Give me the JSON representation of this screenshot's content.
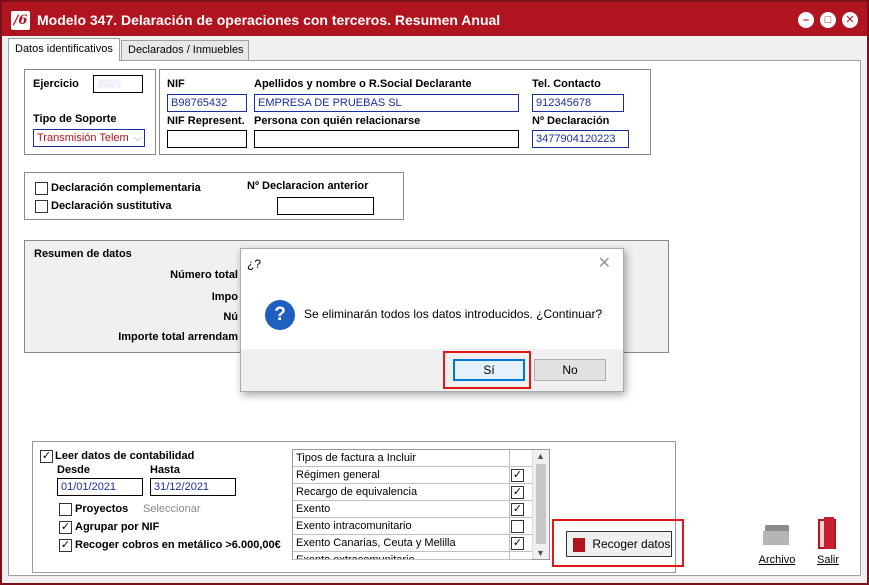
{
  "window": {
    "logo": "/6",
    "title": "Modelo 347. Delaración de operaciones con terceros. Resumen Anual",
    "controls": {
      "minimize": "–",
      "maximize": "□",
      "close": "✕"
    }
  },
  "tabs": [
    {
      "label": "Datos identificativos"
    },
    {
      "label": "Declarados / Inmuebles"
    }
  ],
  "ident": {
    "ejercicio_label": "Ejercicio",
    "ejercicio_value": "2021",
    "tipo_soporte_label": "Tipo de Soporte",
    "tipo_soporte_value": "Transmisión Telem",
    "nif_label": "NIF",
    "nif_value": "B98765432",
    "nombre_label": "Apellidos y nombre o R.Social Declarante",
    "nombre_value": "EMPRESA DE PRUEBAS SL",
    "tel_label": "Tel. Contacto",
    "tel_value": "912345678",
    "nif_rep_label": "NIF Represent.",
    "nif_rep_value": "",
    "persona_label": "Persona con quién relacionarse",
    "persona_value": "",
    "num_decl_label": "Nº Declaración",
    "num_decl_value": "3477904120223"
  },
  "decl": {
    "complementaria_label": "Declaración complementaria",
    "sustitutiva_label": "Declaración sustitutiva",
    "anterior_label": "Nº Declaracion anterior",
    "anterior_value": ""
  },
  "resumen": {
    "title": "Resumen de datos",
    "row1": "Número total",
    "row2": "Impo",
    "row3": "Nú",
    "row4": "Importe total arrendam"
  },
  "dialog": {
    "title": "¿?",
    "close": "✕",
    "icon": "?",
    "message": "Se eliminarán todos los datos introducidos. ¿Continuar?",
    "yes": "Sí",
    "no": "No"
  },
  "contab": {
    "leer_label": "Leer datos de contabilidad",
    "leer_checked": true,
    "desde_label": "Desde",
    "desde_value": "01/01/2021",
    "hasta_label": "Hasta",
    "hasta_value": "31/12/2021",
    "proyectos_label": "Proyectos",
    "proyectos_checked": false,
    "seleccionar_label": "Seleccionar",
    "agrupar_label": "Agrupar por NIF",
    "agrupar_checked": true,
    "cobros_label": "Recoger cobros en metálico >6.000,00€",
    "cobros_checked": true
  },
  "tipos": {
    "header": "Tipos de factura a Incluir",
    "rows": [
      {
        "label": "Régimen general",
        "checked": true
      },
      {
        "label": "Recargo de equivalencia",
        "checked": true
      },
      {
        "label": "Exento",
        "checked": true
      },
      {
        "label": "Exento intracomunitario",
        "checked": false
      },
      {
        "label": "Exento Canarias, Ceuta y Melilla",
        "checked": true
      },
      {
        "label": "Exento extracomunitario",
        "checked": false
      }
    ]
  },
  "actions": {
    "recoger": "Recoger datos",
    "archivo": "Archivo",
    "salir": "Salir"
  },
  "colors": {
    "titlebar": "#b0141f",
    "field_text": "#1a2fa0",
    "highlight": "#e01818"
  }
}
